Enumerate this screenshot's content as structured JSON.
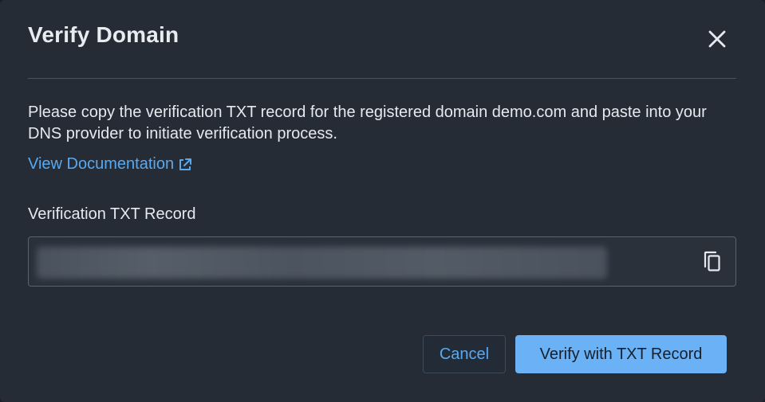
{
  "dialog": {
    "title": "Verify Domain",
    "description": "Please copy the verification TXT record for the registered domain demo.com and paste into your DNS provider to initiate verification process.",
    "doc_link_label": "View Documentation",
    "field_label": "Verification TXT Record",
    "record_value": "",
    "cancel_label": "Cancel",
    "verify_label": "Verify with TXT Record"
  },
  "icons": {
    "close": "close-icon",
    "external_link": "external-link-icon",
    "copy": "copy-icon"
  },
  "colors": {
    "background": "#252c36",
    "link": "#5aa9f0",
    "primary_button": "#6ab2f5",
    "text": "#e6e9ee"
  }
}
